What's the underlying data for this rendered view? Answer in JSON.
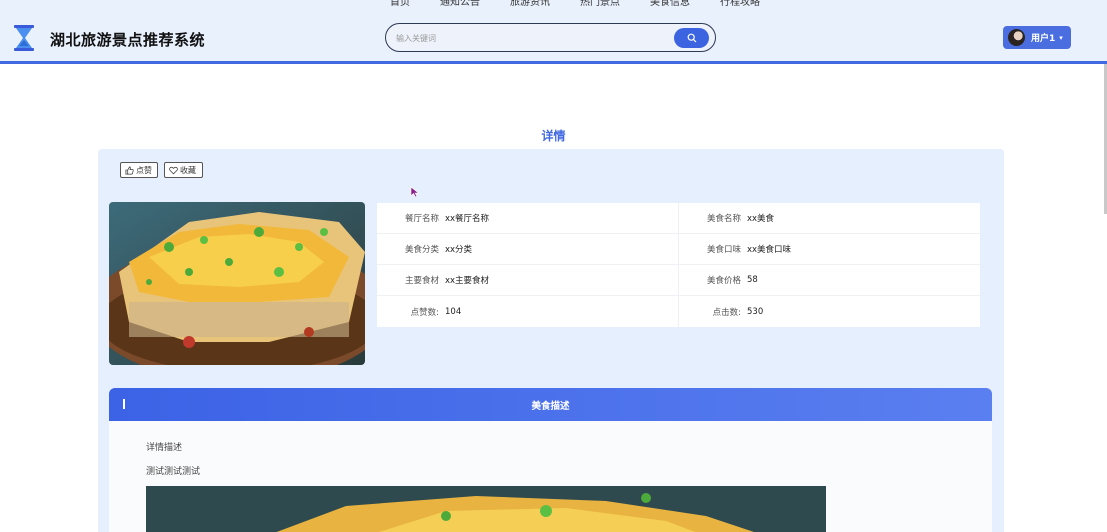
{
  "header": {
    "nav": [
      "首页",
      "通知公告",
      "旅游资讯",
      "热门景点",
      "美食信息",
      "行程攻略"
    ],
    "site_title": "湖北旅游景点推荐系统",
    "search_placeholder": "输入关键词",
    "user_name": "用户1",
    "accent_color": "#4169e1"
  },
  "page": {
    "title": "详情"
  },
  "actions": {
    "like_label": "点赞",
    "favorite_label": "收藏"
  },
  "details": {
    "restaurant_label": "餐厅名称",
    "restaurant_value": "xx餐厅名称",
    "food_name_label": "美食名称",
    "food_name_value": "xx美食",
    "category_label": "美食分类",
    "category_value": "xx分类",
    "taste_label": "美食口味",
    "taste_value": "xx美食口味",
    "ingredients_label": "主要食材",
    "ingredients_value": "xx主要食材",
    "price_label": "美食价格",
    "price_value": "58",
    "likes_label": "点赞数:",
    "likes_value": "104",
    "clicks_label": "点击数:",
    "clicks_value": "530"
  },
  "description": {
    "title": "美食描述",
    "heading": "详情描述",
    "text": "测试测试测试"
  }
}
